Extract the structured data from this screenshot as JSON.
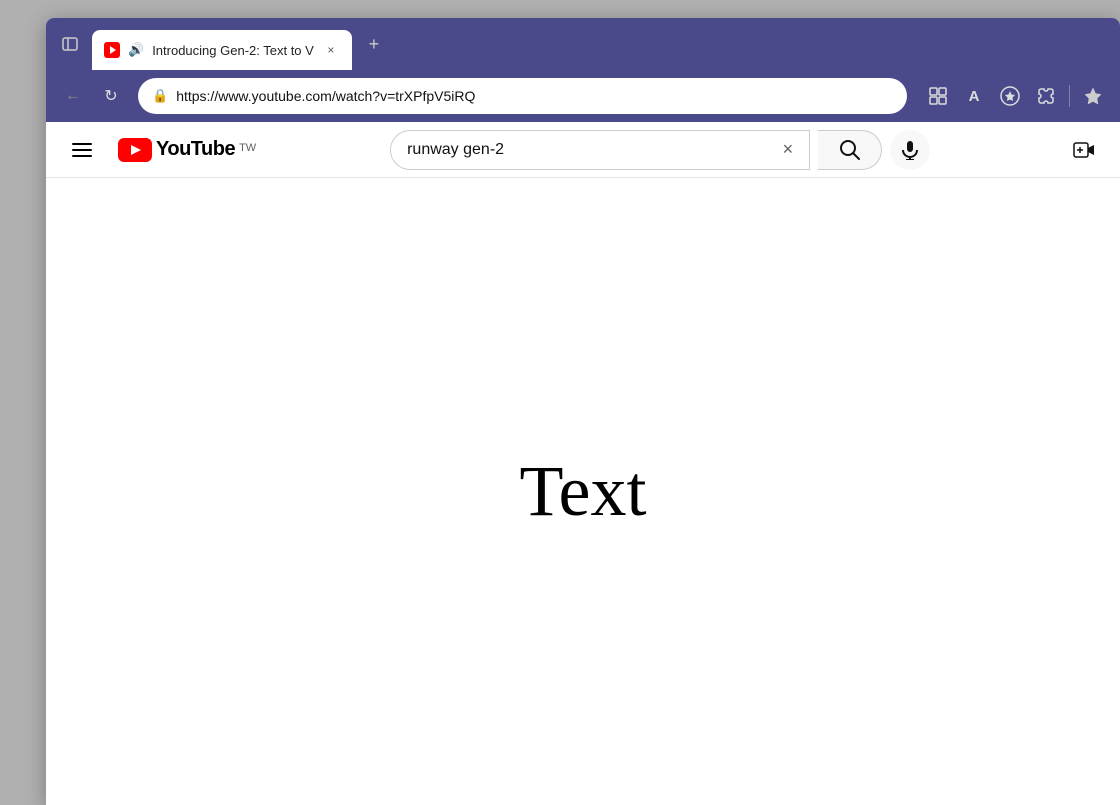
{
  "browser": {
    "tab": {
      "title": "Introducing Gen-2: Text to V",
      "favicon_color": "#ff0000",
      "audio_icon": "🔊",
      "close_icon": "×"
    },
    "new_tab_icon": "+",
    "sidebar_icon": "⬜",
    "nav": {
      "back_label": "←",
      "refresh_label": "↻"
    },
    "address": {
      "url": "https://www.youtube.com/watch?v=trXPfpV5iRQ",
      "lock_icon": "🔒"
    },
    "toolbar": {
      "grid_icon": "⊞",
      "font_icon": "A",
      "star_icon": "☆",
      "extensions_icon": "🧩",
      "divider": "|",
      "fav_icon": "★"
    }
  },
  "youtube": {
    "menu_icon": "☰",
    "logo_text": "YouTube",
    "logo_tw": "TW",
    "search_value": "runway gen-2",
    "search_clear_icon": "×",
    "search_btn_icon": "🔍",
    "voice_btn_icon": "🎤",
    "create_btn_icon": "⊕",
    "main_text": "Text"
  }
}
